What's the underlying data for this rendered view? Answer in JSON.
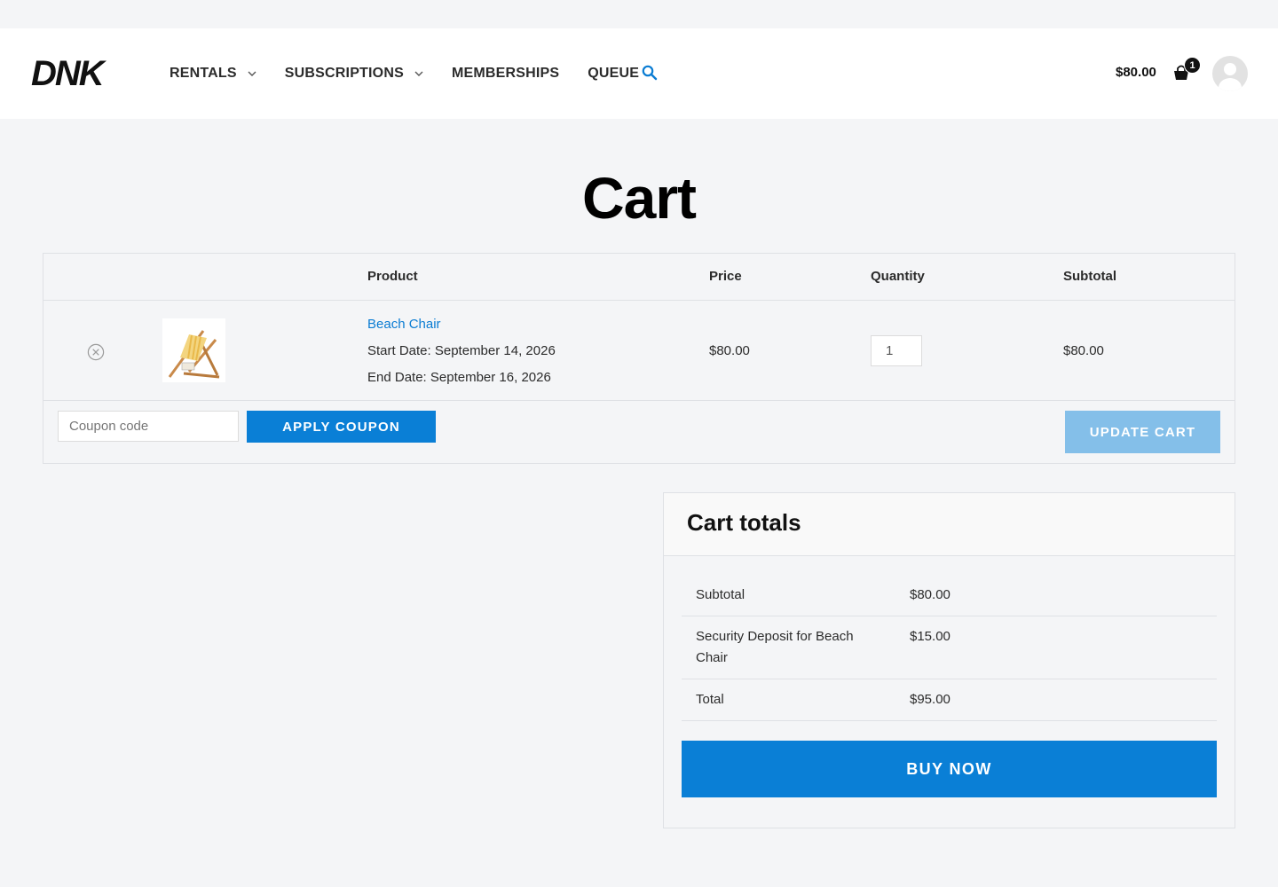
{
  "brand": {
    "logo_text": "DNK"
  },
  "nav": {
    "items": [
      {
        "label": "RENTALS",
        "has_dropdown": true
      },
      {
        "label": "SUBSCRIPTIONS",
        "has_dropdown": true
      },
      {
        "label": "MEMBERSHIPS",
        "has_dropdown": false
      },
      {
        "label": "QUEUE",
        "has_dropdown": false
      }
    ],
    "search_icon": "search-icon"
  },
  "header_cart": {
    "amount": "$80.00",
    "count": "1",
    "icon": "shopping-bag-icon"
  },
  "page": {
    "title": "Cart"
  },
  "cart_table": {
    "headers": {
      "product": "Product",
      "price": "Price",
      "quantity": "Quantity",
      "subtotal": "Subtotal"
    },
    "items": [
      {
        "name": "Beach Chair",
        "start_date": "Start Date: September 14, 2026",
        "end_date": "End Date: September 16, 2026",
        "price": "$80.00",
        "quantity": "1",
        "subtotal": "$80.00"
      }
    ],
    "coupon_placeholder": "Coupon code",
    "apply_coupon_label": "APPLY COUPON",
    "update_cart_label": "UPDATE CART"
  },
  "totals": {
    "title": "Cart totals",
    "rows": [
      {
        "label": "Subtotal",
        "value": "$80.00"
      },
      {
        "label": "Security Deposit for Beach Chair",
        "value": "$15.00"
      },
      {
        "label": "Total",
        "value": "$95.00"
      }
    ],
    "buy_now_label": "BUY NOW"
  },
  "colors": {
    "accent": "#0a7fd6",
    "link": "#0a7cd3",
    "update_disabled": "#84bfe9",
    "page_bg": "#f4f5f7"
  }
}
